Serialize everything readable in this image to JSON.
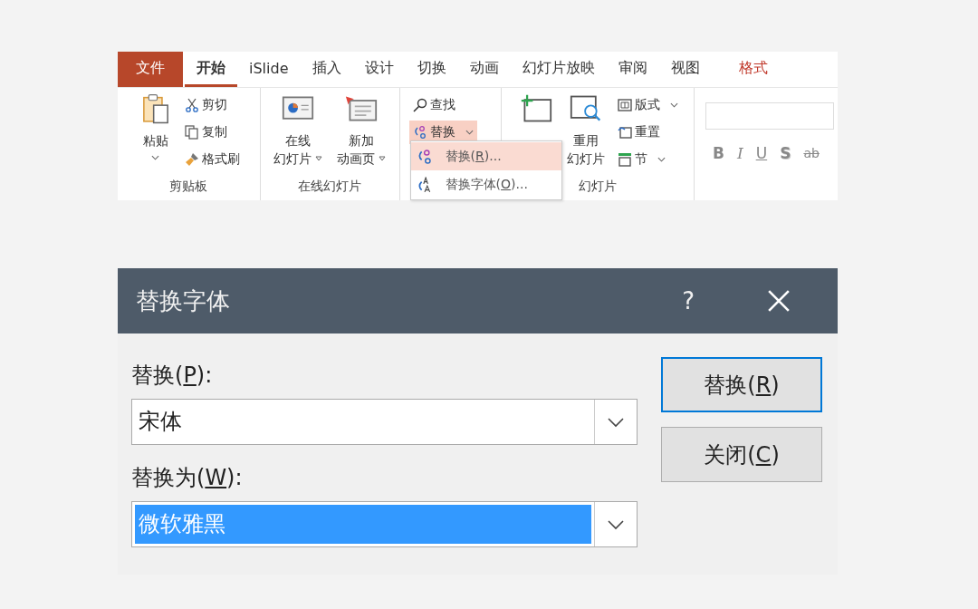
{
  "ribbon": {
    "tabs": [
      {
        "label": "文件",
        "kind": "file",
        "selected": false
      },
      {
        "label": "开始",
        "kind": "normal",
        "selected": true
      },
      {
        "label": "iSlide",
        "kind": "normal",
        "selected": false
      },
      {
        "label": "插入",
        "kind": "normal",
        "selected": false
      },
      {
        "label": "设计",
        "kind": "normal",
        "selected": false
      },
      {
        "label": "切换",
        "kind": "normal",
        "selected": false
      },
      {
        "label": "动画",
        "kind": "normal",
        "selected": false
      },
      {
        "label": "幻灯片放映",
        "kind": "normal",
        "selected": false
      },
      {
        "label": "审阅",
        "kind": "normal",
        "selected": false
      },
      {
        "label": "视图",
        "kind": "normal",
        "selected": false
      },
      {
        "label": "格式",
        "kind": "contextual",
        "selected": false
      }
    ],
    "clipboard": {
      "paste": "粘贴",
      "cut": "剪切",
      "copy": "复制",
      "format_painter": "格式刷",
      "group": "剪贴板"
    },
    "online": {
      "online_slides": [
        "在线",
        "幻灯片"
      ],
      "new_animation": [
        "新加",
        "动画页"
      ],
      "group": "在线幻灯片"
    },
    "editing": {
      "find": "查找",
      "replace": "替换",
      "menu": [
        {
          "label_parts": [
            "替换(",
            "R",
            ")..."
          ],
          "kind": "replace",
          "selected": true
        },
        {
          "label_parts": [
            "替换字体(",
            "O",
            ")..."
          ],
          "kind": "replace_font",
          "selected": false
        }
      ]
    },
    "slides": {
      "reuse": [
        "重用",
        "幻灯片"
      ],
      "layout": "版式",
      "reset": "重置",
      "section": "节",
      "group": "幻灯片"
    },
    "font": {
      "buttons": [
        {
          "label": "B",
          "kind": "bold"
        },
        {
          "label": "I",
          "kind": "italic"
        },
        {
          "label": "U",
          "kind": "underline"
        },
        {
          "label": "S",
          "kind": "shadow"
        },
        {
          "label": "ab",
          "kind": "strike"
        }
      ]
    }
  },
  "dialog": {
    "title": "替换字体",
    "help": "?",
    "fields": [
      {
        "label_parts": [
          "替换(",
          "P",
          "):"
        ],
        "value": "宋体",
        "selected": false
      },
      {
        "label_parts": [
          "替换为(",
          "W",
          "):"
        ],
        "value": "微软雅黑",
        "selected": true
      }
    ],
    "buttons": [
      {
        "label_parts": [
          "替换(",
          "R",
          ")"
        ],
        "default": true
      },
      {
        "label_parts": [
          "关闭(",
          "C",
          ")"
        ],
        "default": false
      }
    ]
  }
}
